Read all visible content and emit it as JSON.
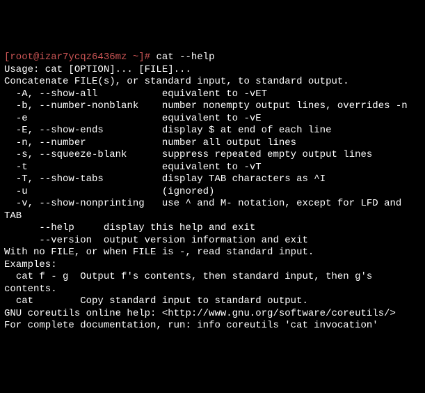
{
  "prompt": {
    "open": "[",
    "user_host": "root@izar7ycqz6436mz",
    "tilde": " ~",
    "close": "]",
    "hash": "# ",
    "command": "cat --help"
  },
  "output": {
    "usage": "Usage: cat [OPTION]... [FILE]...",
    "desc": "Concatenate FILE(s), or standard input, to standard output.",
    "blank": "",
    "opt_A": "  -A, --show-all           equivalent to -vET",
    "opt_b": "  -b, --number-nonblank    number nonempty output lines, overrides -n",
    "opt_e": "  -e                       equivalent to -vE",
    "opt_E": "  -E, --show-ends          display $ at end of each line",
    "opt_n": "  -n, --number             number all output lines",
    "opt_s": "  -s, --squeeze-blank      suppress repeated empty output lines",
    "opt_t": "  -t                       equivalent to -vT",
    "opt_T": "  -T, --show-tabs          display TAB characters as ^I",
    "opt_u": "  -u                       (ignored)",
    "opt_v": "  -v, --show-nonprinting   use ^ and M- notation, except for LFD and TAB",
    "opt_help": "      --help     display this help and exit",
    "opt_version": "      --version  output version information and exit",
    "nofile": "With no FILE, or when FILE is -, read standard input.",
    "examples_hdr": "Examples:",
    "ex1": "  cat f - g  Output f's contents, then standard input, then g's contents.",
    "ex2": "  cat        Copy standard input to standard output.",
    "help_url": "GNU coreutils online help: <http://www.gnu.org/software/coreutils/>",
    "info": "For complete documentation, run: info coreutils 'cat invocation'"
  }
}
